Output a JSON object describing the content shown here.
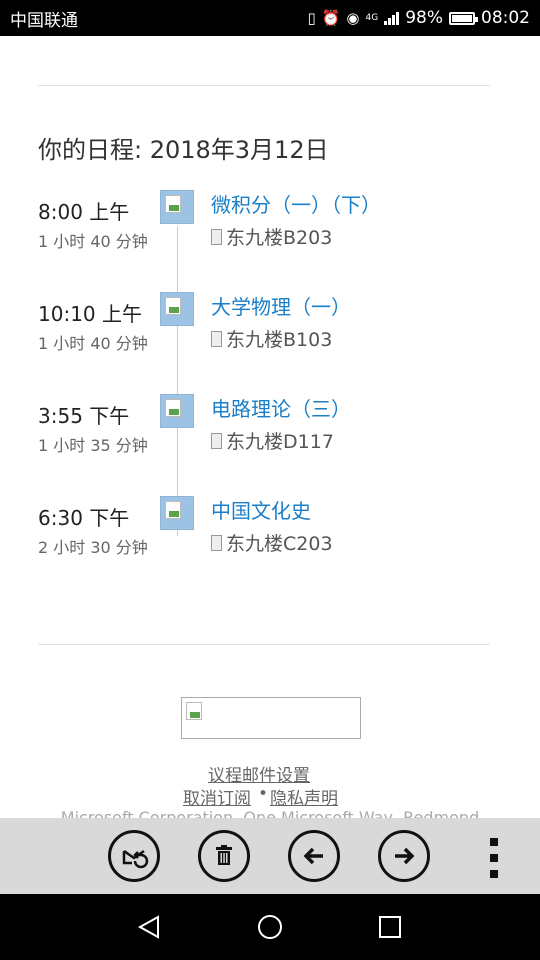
{
  "status_bar": {
    "carrier": "中国联通",
    "network": "4G",
    "battery": "98%",
    "battery_level": 0.98,
    "time": "08:02"
  },
  "agenda": {
    "heading": "你的日程: 2018年3月12日",
    "events": [
      {
        "time": "8:00 上午",
        "duration": "1 小时 40 分钟",
        "title": "微积分（一）（下）",
        "location": "东九楼B203"
      },
      {
        "time": "10:10 上午",
        "duration": "1 小时 40 分钟",
        "title": "大学物理（一）",
        "location": "东九楼B103"
      },
      {
        "time": "3:55 下午",
        "duration": "1 小时 35 分钟",
        "title": "电路理论（三）",
        "location": "东九楼D117"
      },
      {
        "time": "6:30 下午",
        "duration": "2 小时 30 分钟",
        "title": "中国文化史",
        "location": "东九楼C203"
      }
    ]
  },
  "footer": {
    "settings_link": "议程邮件设置",
    "unsubscribe_link": "取消订阅",
    "separator": "•",
    "privacy_link": "隐私声明",
    "corporation": "Microsoft Corporation, One Microsoft Way, Redmond"
  },
  "toolbar": {
    "buttons": [
      "reply-all-icon",
      "trash-icon",
      "arrow-left-icon",
      "arrow-right-icon",
      "more-icon"
    ]
  },
  "navigation": {
    "buttons": [
      "back-triangle-icon",
      "home-circle-icon",
      "recents-square-icon"
    ]
  }
}
